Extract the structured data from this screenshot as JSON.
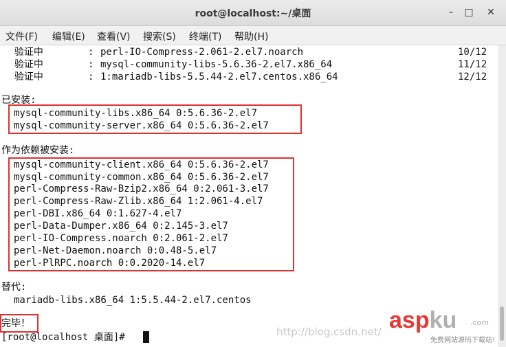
{
  "window": {
    "title": "root@localhost:~/桌面",
    "minimize": "–",
    "maximize": "□",
    "close": "✕"
  },
  "menu": [
    "文件(F)",
    "编辑(E)",
    "查看(V)",
    "搜索(S)",
    "终端(T)",
    "帮助(H)"
  ],
  "terminal": {
    "verify_rows": [
      {
        "label": "  验证中",
        "sep": ":",
        "pkg": "perl-IO-Compress-2.061-2.el7.noarch",
        "count": "10/12"
      },
      {
        "label": "  验证中",
        "sep": ":",
        "pkg": "mysql-community-libs-5.6.36-2.el7.x86_64",
        "count": "11/12"
      },
      {
        "label": "  验证中",
        "sep": ":",
        "pkg": "1:mariadb-libs-5.5.44-2.el7.centos.x86_64",
        "count": "12/12"
      }
    ],
    "installed_header": "已安装:",
    "installed": [
      "mysql-community-libs.x86_64 0:5.6.36-2.el7",
      "mysql-community-server.x86_64 0:5.6.36-2.el7"
    ],
    "deps_header": "作为依赖被安装:",
    "deps": [
      "mysql-community-client.x86_64 0:5.6.36-2.el7",
      "mysql-community-common.x86_64 0:5.6.36-2.el7",
      "perl-Compress-Raw-Bzip2.x86_64 0:2.061-3.el7",
      "perl-Compress-Raw-Zlib.x86_64 1:2.061-4.el7",
      "perl-DBI.x86_64 0:1.627-4.el7",
      "perl-Data-Dumper.x86_64 0:2.145-3.el7",
      "perl-IO-Compress.noarch 0:2.061-2.el7",
      "perl-Net-Daemon.noarch 0:0.48-5.el7",
      "perl-PlRPC.noarch 0:0.2020-14.el7"
    ],
    "replaced_header": "替代:",
    "replaced": [
      "mariadb-libs.x86_64 1:5.5.44-2.el7.centos"
    ],
    "done": "完毕！",
    "prompt": "[root@localhost 桌面]# "
  },
  "watermark": "http://blog.csdn.net/",
  "logo": {
    "main": "asp",
    "accent": "ku",
    "suffix": ".com",
    "tagline": "免费网站源码下载站!"
  }
}
